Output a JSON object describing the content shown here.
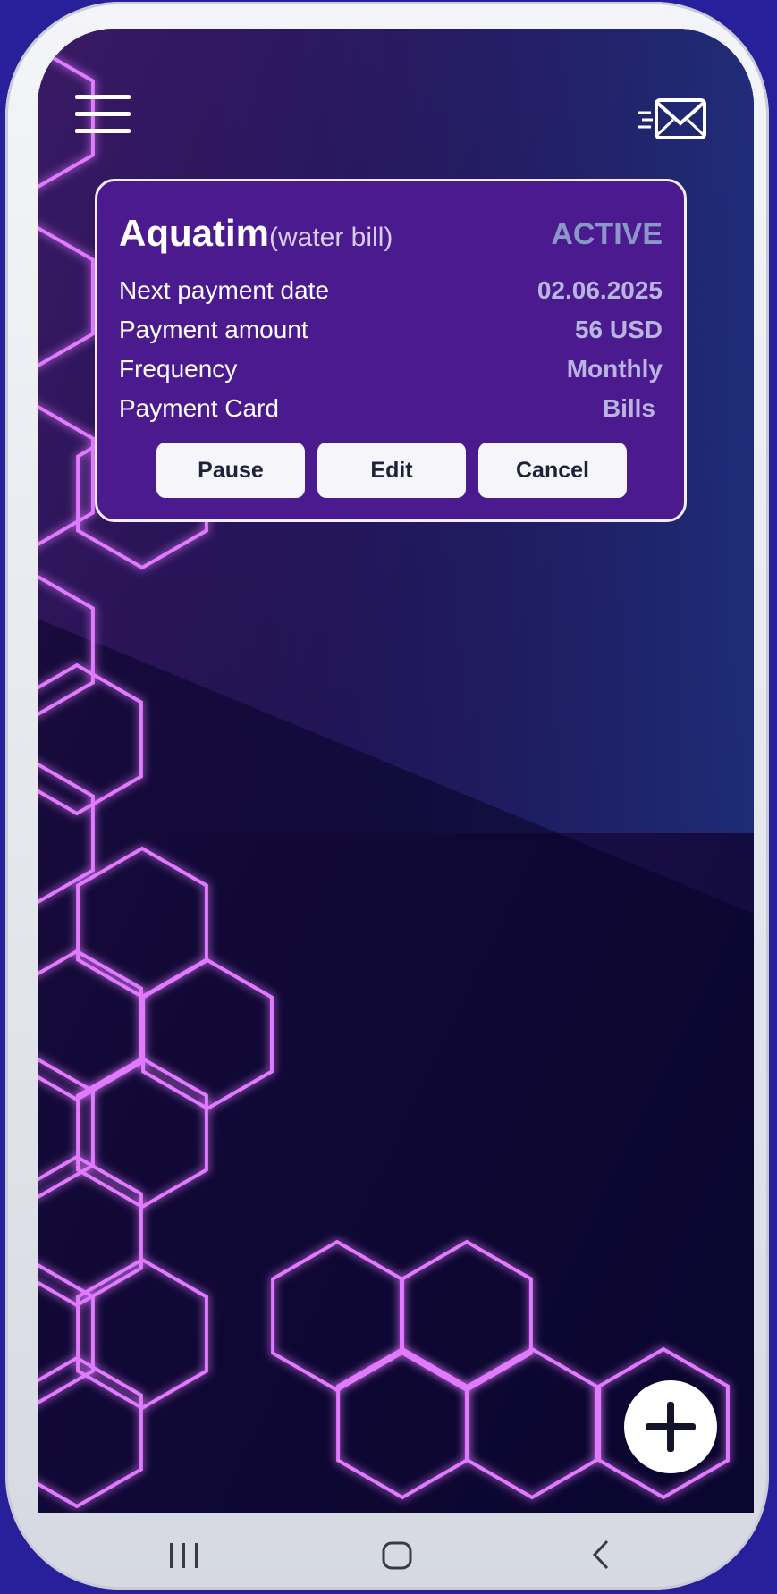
{
  "bill": {
    "name": "Aquatim",
    "subtitle": "(water bill)",
    "status": "ACTIVE",
    "rows": [
      {
        "label": "Next payment date",
        "value": "02.06.2025"
      },
      {
        "label": "Payment amount",
        "value": "56 USD"
      },
      {
        "label": "Frequency",
        "value": "Monthly"
      },
      {
        "label": "Payment Card",
        "value": "Bills"
      }
    ],
    "actions": {
      "pause": "Pause",
      "edit": "Edit",
      "cancel": "Cancel"
    }
  },
  "icons": {
    "menu": "hamburger-menu-icon",
    "mail": "mail-send-icon",
    "add": "plus-icon",
    "nav_recent": "recent-apps-icon",
    "nav_home": "home-icon",
    "nav_back": "back-icon"
  },
  "colors": {
    "background": "#28209a",
    "card": "#4a1a8e",
    "status": "#8b97c8",
    "hex_glow": "#d56cff"
  }
}
